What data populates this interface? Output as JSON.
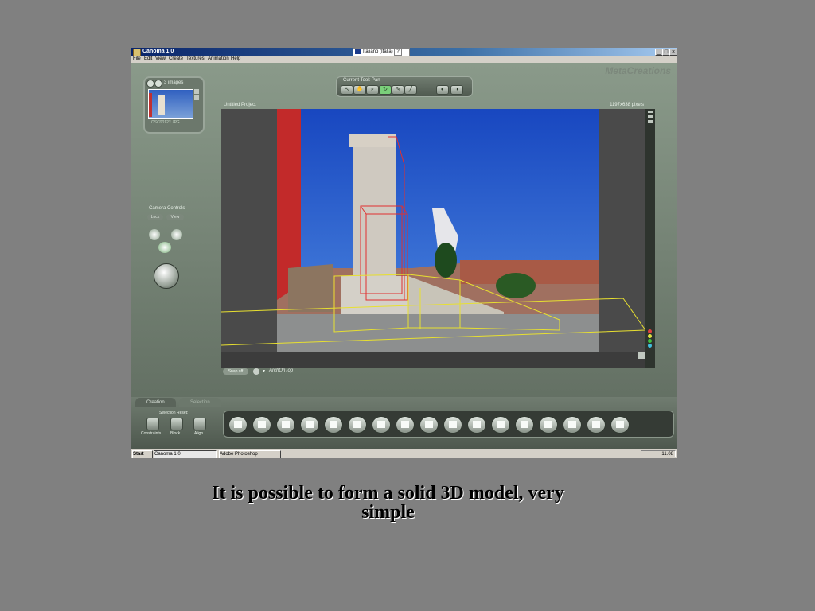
{
  "window": {
    "title": "Canoma 1.0",
    "controls": [
      "_",
      "□",
      "×"
    ]
  },
  "menubar": {
    "items": [
      "File",
      "Edit",
      "View",
      "Create",
      "Textures",
      "Animation",
      "Help"
    ],
    "language": "Italiano (Italia)",
    "help_icon": "question-icon"
  },
  "images_panel": {
    "count_label": "3 images",
    "thumbnail_caption": "DSC00123.JPG"
  },
  "toolbar": {
    "current_tool_label": "Current Tool: Pan"
  },
  "brand": {
    "logo": "MetaCreations"
  },
  "project": {
    "name": "Untitled Project",
    "size": "1197x638 pixels"
  },
  "camera_controls": {
    "title": "Camera Controls",
    "tabs": [
      "Lock",
      "View"
    ]
  },
  "status": {
    "snap_label": "Snap off",
    "object_name": "ArchOnTop"
  },
  "bottom_panel": {
    "tabs": [
      "Creation",
      "Selection"
    ],
    "selection_reset_label": "Selection Reset:",
    "selection_buttons": [
      "Constraints",
      "Block",
      "Align"
    ]
  },
  "taskbar": {
    "start_label": "Start",
    "tasks": [
      "Canoma 1.0",
      "Adobe Photoshop"
    ],
    "clock": "11.08"
  },
  "caption": {
    "line1": "It is possible to form a solid 3D model, very",
    "line2": "simple"
  },
  "colors": {
    "wireframe_red": "#e03030",
    "wireframe_yellow": "#e8e030",
    "sky_blue": "#1d56c8"
  }
}
